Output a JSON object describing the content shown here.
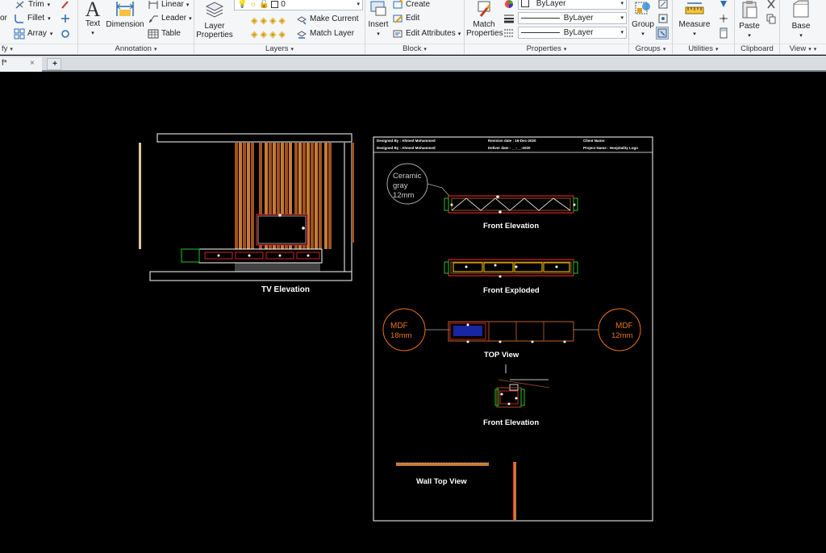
{
  "ribbon": {
    "modify": {
      "title": "fy",
      "trim": "Trim",
      "fillet": "Fillet",
      "array": "Array",
      "or": "or"
    },
    "annotation": {
      "title": "Annotation",
      "text": "Text",
      "dimension": "Dimension",
      "linear": "Linear",
      "leader": "Leader",
      "table": "Table"
    },
    "layers": {
      "title": "Layers",
      "layer_properties_line1": "Layer",
      "layer_properties_line2": "Properties",
      "current_layer": "0",
      "make_current": "Make Current",
      "match_layer": "Match Layer"
    },
    "block": {
      "title": "Block",
      "insert": "Insert",
      "create": "Create",
      "edit": "Edit",
      "edit_attributes": "Edit Attributes"
    },
    "properties": {
      "title": "Properties",
      "match_line1": "Match",
      "match_line2": "Properties",
      "color": "ByLayer",
      "linetype": "ByLayer",
      "lineweight": "ByLayer"
    },
    "groups": {
      "title": "Groups",
      "group": "Group"
    },
    "utilities": {
      "title": "Utilities",
      "measure": "Measure"
    },
    "clipboard": {
      "title": "Clipboard",
      "paste": "Paste"
    },
    "view": {
      "title": "View",
      "base": "Base"
    }
  },
  "tabs": {
    "drawing": "f*",
    "close": "×",
    "new": "+"
  },
  "drawing": {
    "tv_elevation": "TV Elevation",
    "title_block": {
      "designed_by_1": "Designed By : Ahmed Mohammed",
      "revision_date": "Revision date : 16-Dec-2020",
      "client_name": "Client Name:",
      "designed_by_2": "Designed By : Ahmed Mohammed",
      "deliver_date": "Deliver date : __-__-2020",
      "project_name": "Project Name : Hospitality Logo"
    },
    "material_ceramic": [
      "Ceramic",
      "gray",
      "12mm"
    ],
    "material_mdf_left": [
      "MDF",
      "18mm"
    ],
    "material_mdf_right": [
      "MDF",
      "12mm"
    ],
    "front_elevation": "Front Elevation",
    "front_exploded": "Front Exploded",
    "top_view": "TOP View",
    "front_elevation_2": "Front Elevation",
    "wall_top_view": "Wall Top View"
  },
  "colors": {
    "wood": "#a0521e",
    "wood_light": "#c77a35",
    "mdf_orange": "#e8731c",
    "cad_red": "#ff2a2a",
    "cad_yellow": "#ffd200",
    "cad_green": "#23c425",
    "cad_white": "#ffffff",
    "cad_blue": "#1f2fc9"
  }
}
